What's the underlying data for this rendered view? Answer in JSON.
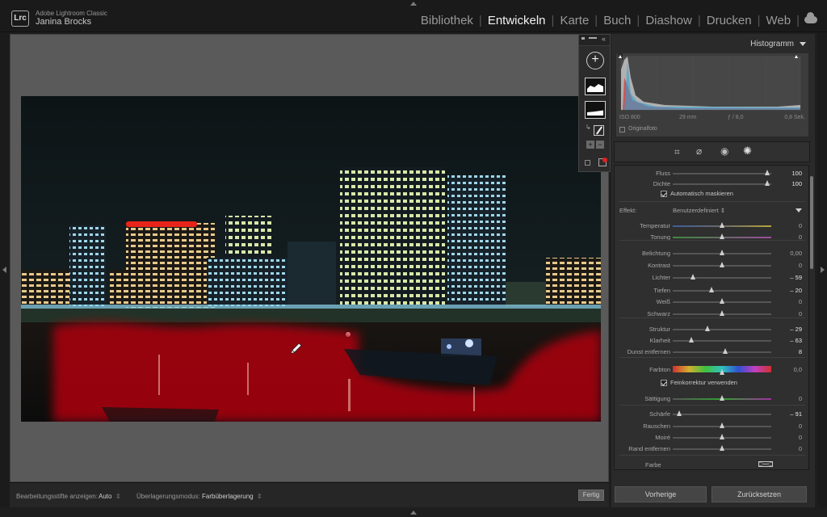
{
  "app": {
    "name": "Adobe Lightroom Classic",
    "logo": "Lrc",
    "user": "Janina Brocks"
  },
  "modules": [
    {
      "label": "Bibliothek",
      "active": false
    },
    {
      "label": "Entwickeln",
      "active": true
    },
    {
      "label": "Karte",
      "active": false
    },
    {
      "label": "Buch",
      "active": false
    },
    {
      "label": "Diashow",
      "active": false
    },
    {
      "label": "Drucken",
      "active": false
    },
    {
      "label": "Web",
      "active": false
    }
  ],
  "bottombar": {
    "pins_label": "Bearbeitungsstifte anzeigen:",
    "pins_value": "Auto",
    "overlay_label": "Überlagerungsmodus:",
    "overlay_value": "Farbüberlagerung",
    "done": "Fertig"
  },
  "histogram": {
    "title": "Histogramm",
    "iso": "ISO 800",
    "focal": "29 mm",
    "aperture": "ƒ / 8,0",
    "shutter": "0,8 Sek.",
    "original_photo": "Originalfoto"
  },
  "brush": {
    "flow_label": "Fluss",
    "flow_value": "100",
    "density_label": "Dichte",
    "density_value": "100",
    "automask_label": "Automatisch maskieren",
    "effect_label": "Effekt:",
    "effect_value": "Benutzerdefiniert"
  },
  "sliders": [
    {
      "label": "Temperatur",
      "value": "0",
      "pos": 0.5,
      "track": "temp"
    },
    {
      "label": "Tonung",
      "value": "0",
      "pos": 0.5,
      "track": "tint"
    },
    {
      "label": "Belichtung",
      "value": "0,00",
      "pos": 0.5
    },
    {
      "label": "Kontrast",
      "value": "0",
      "pos": 0.5
    },
    {
      "label": "Lichter",
      "value": "– 59",
      "pos": 0.21,
      "active": true
    },
    {
      "label": "Tiefen",
      "value": "– 20",
      "pos": 0.4,
      "active": true
    },
    {
      "label": "Weiß",
      "value": "0",
      "pos": 0.5
    },
    {
      "label": "Schwarz",
      "value": "0",
      "pos": 0.5
    },
    {
      "label": "Struktur",
      "value": "– 29",
      "pos": 0.36,
      "active": true
    },
    {
      "label": "Klarheit",
      "value": "– 63",
      "pos": 0.19,
      "active": true
    },
    {
      "label": "Dunst entfernen",
      "value": "8",
      "pos": 0.54,
      "active": true
    }
  ],
  "color": {
    "hue_label": "Farbton",
    "hue_value": "0,0",
    "fine_label": "Feinkorrektur verwenden",
    "saturation_label": "Sättigung",
    "saturation_value": "0",
    "sharpness_label": "Schärfe",
    "sharpness_value": "– 91",
    "noise_label": "Rauschen",
    "noise_value": "0",
    "moire_label": "Moiré",
    "moire_value": "0",
    "fringe_label": "Rand entfernen",
    "fringe_value": "0",
    "color_label": "Farbe"
  },
  "footer": {
    "previous": "Vorherige",
    "reset": "Zurücksetzen"
  },
  "colors": {
    "mask_overlay": "#b3000e",
    "accent_active": "#f2f2f2"
  }
}
